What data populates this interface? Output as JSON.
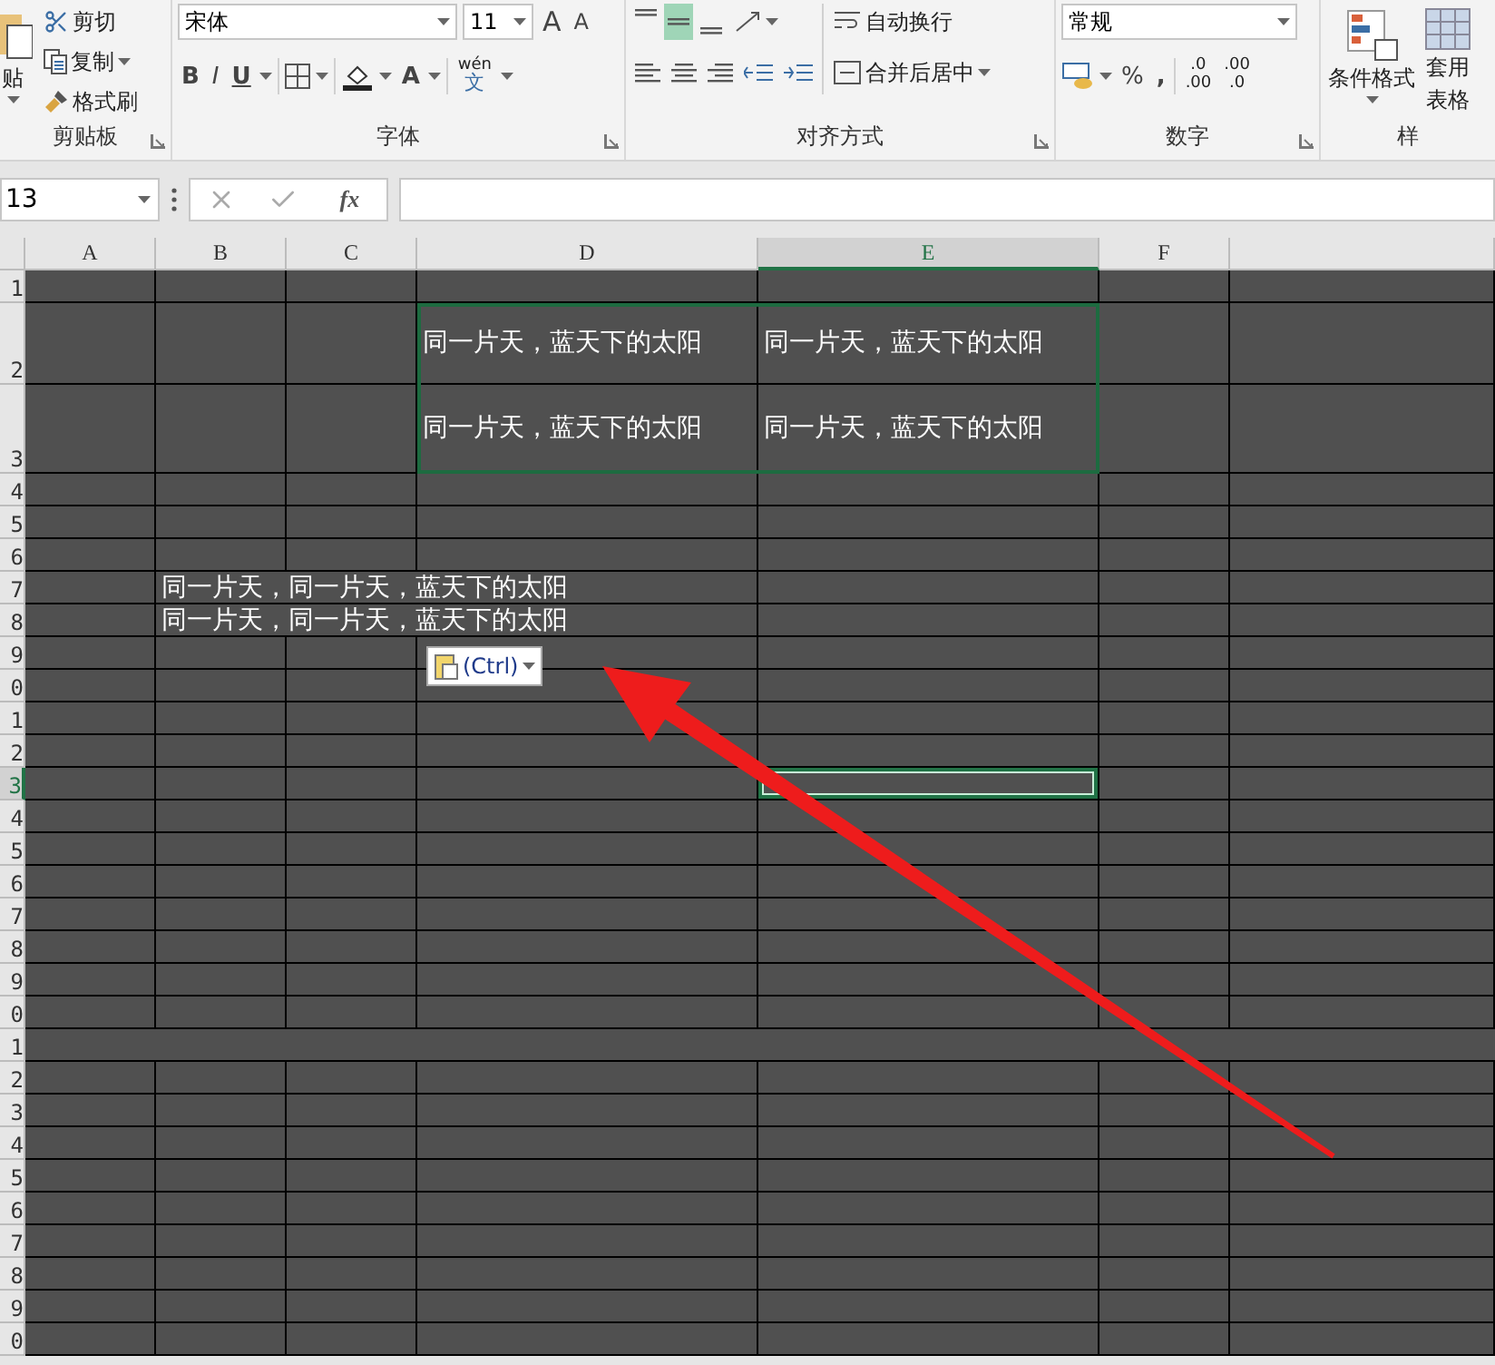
{
  "ribbon": {
    "clipboard": {
      "paste": "贴",
      "cut": "剪切",
      "copy": "复制",
      "format_painter": "格式刷",
      "label": "剪贴板"
    },
    "font": {
      "name": "宋体",
      "size": "11",
      "grow": "A",
      "shrink": "A",
      "bold": "B",
      "italic": "I",
      "underline": "U",
      "font_color": "A",
      "phonetic_top": "wén",
      "phonetic_bottom": "文",
      "label": "字体"
    },
    "alignment": {
      "vertical": [
        {
          "selected": false
        },
        {
          "selected": true
        },
        {
          "selected": false
        }
      ],
      "horizontal": [
        {
          "selected": false
        },
        {
          "selected": false
        },
        {
          "selected": false
        }
      ],
      "wrap_text": "自动换行",
      "merge_center": "合并后居中",
      "label": "对齐方式"
    },
    "number": {
      "format": "常规",
      "percent": "%",
      "comma": ",",
      "inc_decimal": [
        ".0",
        ".00"
      ],
      "dec_decimal": [
        ".00",
        ".0"
      ],
      "label": "数字"
    },
    "styles": {
      "conditional": "条件格式",
      "table_top": "套用",
      "table_bottom": "表格",
      "label": "样"
    }
  },
  "formula_bar": {
    "name_box": "13",
    "fx": "fx"
  },
  "columns": [
    {
      "label": "A",
      "selected": false
    },
    {
      "label": "B",
      "selected": false
    },
    {
      "label": "C",
      "selected": false
    },
    {
      "label": "D",
      "selected": false
    },
    {
      "label": "E",
      "selected": true
    },
    {
      "label": "F",
      "selected": false
    },
    {
      "selected": false
    }
  ],
  "rows": [
    {
      "label": "1",
      "selected": false,
      "merged": false,
      "cells": {}
    },
    {
      "label": "2",
      "selected": false,
      "merged": false,
      "cells": {
        "D": "同一片天，蓝天下的太阳",
        "E": "同一片天，蓝天下的太阳"
      }
    },
    {
      "label": "3",
      "selected": false,
      "merged": false,
      "cells": {
        "D": "同一片天，蓝天下的太阳",
        "E": "同一片天，蓝天下的太阳"
      }
    },
    {
      "label": "4",
      "selected": false,
      "merged": false,
      "cells": {}
    },
    {
      "label": "5",
      "selected": false,
      "merged": false,
      "cells": {}
    },
    {
      "label": "6",
      "selected": false,
      "merged": false,
      "cells": {}
    },
    {
      "label": "7",
      "selected": false,
      "merged": false,
      "cells": {
        "B": "同一片天，同一片天，蓝天下的太阳"
      }
    },
    {
      "label": "8",
      "selected": false,
      "merged": false,
      "cells": {
        "B": "同一片天，同一片天，蓝天下的太阳"
      }
    },
    {
      "label": "9",
      "selected": false,
      "merged": false,
      "cells": {}
    },
    {
      "label": "0",
      "selected": false,
      "merged": false,
      "cells": {}
    },
    {
      "label": "1",
      "selected": false,
      "merged": false,
      "cells": {}
    },
    {
      "label": "2",
      "selected": false,
      "merged": false,
      "cells": {}
    },
    {
      "label": "3",
      "selected": true,
      "merged": false,
      "cells": {}
    },
    {
      "label": "4",
      "selected": false,
      "merged": false,
      "cells": {}
    },
    {
      "label": "5",
      "selected": false,
      "merged": false,
      "cells": {}
    },
    {
      "label": "6",
      "selected": false,
      "merged": false,
      "cells": {}
    },
    {
      "label": "7",
      "selected": false,
      "merged": false,
      "cells": {}
    },
    {
      "label": "8",
      "selected": false,
      "merged": false,
      "cells": {}
    },
    {
      "label": "9",
      "selected": false,
      "merged": false,
      "cells": {}
    },
    {
      "label": "0",
      "selected": false,
      "merged": false,
      "cells": {}
    },
    {
      "label": "1",
      "selected": false,
      "merged": true,
      "cells": {}
    },
    {
      "label": "2",
      "selected": false,
      "merged": false,
      "cells": {}
    },
    {
      "label": "3",
      "selected": false,
      "merged": false,
      "cells": {}
    },
    {
      "label": "4",
      "selected": false,
      "merged": false,
      "cells": {}
    },
    {
      "label": "5",
      "selected": false,
      "merged": false,
      "cells": {}
    },
    {
      "label": "6",
      "selected": false,
      "merged": false,
      "cells": {}
    },
    {
      "label": "7",
      "selected": false,
      "merged": false,
      "cells": {}
    },
    {
      "label": "8",
      "selected": false,
      "merged": false,
      "cells": {}
    },
    {
      "label": "9",
      "selected": false,
      "merged": false,
      "cells": {}
    },
    {
      "label": "0",
      "selected": false,
      "merged": false,
      "cells": {}
    }
  ],
  "copy_marquee": true,
  "paste_options": {
    "label": "(Ctrl)"
  }
}
